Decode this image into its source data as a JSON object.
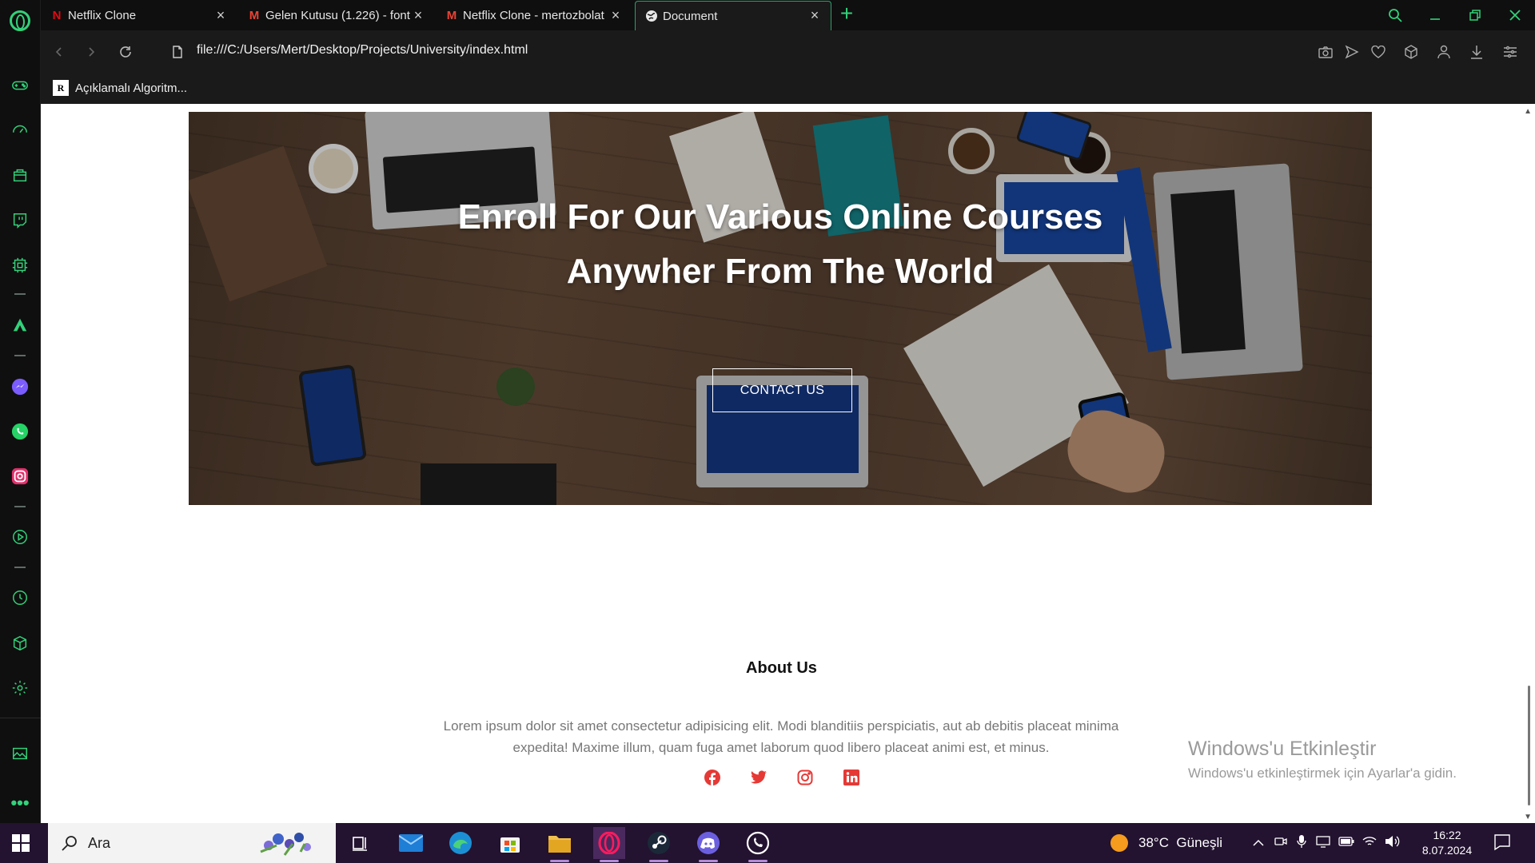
{
  "browser": {
    "tabs": [
      {
        "title": "Netflix Clone",
        "favicon": "netflix-icon",
        "active": false
      },
      {
        "title": "Gelen Kutusu (1.226) - font",
        "favicon": "gmail-icon",
        "active": false
      },
      {
        "title": "Netflix Clone - mertozbolat",
        "favicon": "gmail-icon",
        "active": false
      },
      {
        "title": "Document",
        "favicon": "globe-icon",
        "active": true
      }
    ],
    "url": "file:///C:/Users/Mert/Desktop/Projects/University/index.html",
    "bookmarks": [
      {
        "icon_text": "R",
        "label": "Açıklamalı Algoritm..."
      }
    ],
    "accent_color": "#33d17a"
  },
  "page": {
    "hero": {
      "title_line1": "Enroll For Our Various Online Courses",
      "title_line2": "Anywher From The World",
      "button_label": "CONTACT US"
    },
    "about": {
      "title": "About Us",
      "text": "Lorem ipsum dolor sit amet consectetur adipisicing elit. Modi blanditiis perspiciatis, aut ab debitis placeat minima expedita! Maxime illum, quam fuga amet laborum quod libero placeat animi est, et minus.",
      "socials": [
        "facebook-icon",
        "twitter-icon",
        "instagram-icon",
        "linkedin-icon"
      ],
      "social_color": "#e53935"
    }
  },
  "windows_watermark": {
    "line1": "Windows'u Etkinleştir",
    "line2": "Windows'u etkinleştirmek için Ayarlar'a gidin."
  },
  "taskbar": {
    "search_label": "Ara",
    "weather": "38°C  Güneşli",
    "time": "16:22",
    "date": "8.07.2024"
  }
}
